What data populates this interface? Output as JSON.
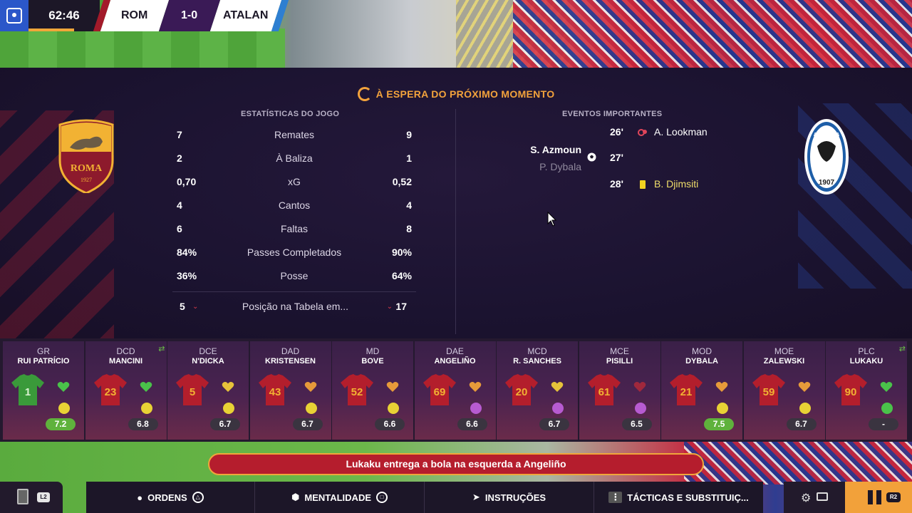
{
  "scoreboard": {
    "time": "62:46",
    "home": "ROM",
    "score": "1-0",
    "away": "ATALAN",
    "colors": {
      "home": "#a31a2a",
      "away": "#2e7fd1",
      "accent": "#f0a63a"
    }
  },
  "status": "À ESPERA DO PRÓXIMO MOMENTO",
  "stats": {
    "title": "ESTATÍSTICAS DO JOGO",
    "rows": [
      {
        "home": "7",
        "label": "Remates",
        "away": "9"
      },
      {
        "home": "2",
        "label": "À Baliza",
        "away": "1"
      },
      {
        "home": "0,70",
        "label": "xG",
        "away": "0,52"
      },
      {
        "home": "4",
        "label": "Cantos",
        "away": "4"
      },
      {
        "home": "6",
        "label": "Faltas",
        "away": "8"
      },
      {
        "home": "84%",
        "label": "Passes Completados",
        "away": "90%"
      },
      {
        "home": "36%",
        "label": "Posse",
        "away": "64%"
      }
    ],
    "table": {
      "home": "5",
      "label": "Posição na Tabela em...",
      "away": "17"
    }
  },
  "crests": {
    "home": {
      "name": "ROMA",
      "year": "1927"
    },
    "away": {
      "name": "ATALANTA",
      "year": "1907"
    }
  },
  "events": {
    "title": "EVENTOS IMPORTANTES",
    "items": [
      {
        "minute": "26'",
        "type": "injury-icon",
        "player": "A. Lookman",
        "side": "away"
      },
      {
        "minute": "27'",
        "type": "goal-icon",
        "player": "S. Azmoun",
        "assist": "P. Dybala",
        "side": "home"
      },
      {
        "minute": "28'",
        "type": "yellow-card-icon",
        "player": "B. Djimsiti",
        "side": "away"
      }
    ]
  },
  "players": [
    {
      "pos": "GR",
      "name": "RUI PATRÍCIO",
      "number": "1",
      "kit": "gk",
      "condition": "green",
      "morale": "yellow",
      "rating": "7.2",
      "good": true,
      "swap": false
    },
    {
      "pos": "DCD",
      "name": "MANCINI",
      "number": "23",
      "kit": "outfield",
      "condition": "green",
      "morale": "yellow",
      "rating": "6.8",
      "good": false,
      "swap": true
    },
    {
      "pos": "DCE",
      "name": "N'DICKA",
      "number": "5",
      "kit": "outfield",
      "condition": "yellow",
      "morale": "yellow",
      "rating": "6.7",
      "good": false,
      "swap": false
    },
    {
      "pos": "DAD",
      "name": "KRISTENSEN",
      "number": "43",
      "kit": "outfield",
      "condition": "orange",
      "morale": "yellow",
      "rating": "6.7",
      "good": false,
      "swap": false
    },
    {
      "pos": "MD",
      "name": "BOVE",
      "number": "52",
      "kit": "outfield",
      "condition": "orange",
      "morale": "yellow",
      "rating": "6.6",
      "good": false,
      "swap": false
    },
    {
      "pos": "DAE",
      "name": "ANGELIÑO",
      "number": "69",
      "kit": "outfield",
      "condition": "orange",
      "morale": "purple",
      "rating": "6.6",
      "good": false,
      "swap": false
    },
    {
      "pos": "MCD",
      "name": "R. SANCHES",
      "number": "20",
      "kit": "outfield",
      "condition": "yellow",
      "morale": "purple",
      "rating": "6.7",
      "good": false,
      "swap": false
    },
    {
      "pos": "MCE",
      "name": "PISILLI",
      "number": "61",
      "kit": "outfield",
      "condition": "red",
      "morale": "purple",
      "rating": "6.5",
      "good": false,
      "swap": false
    },
    {
      "pos": "MOD",
      "name": "DYBALA",
      "number": "21",
      "kit": "outfield",
      "condition": "orange",
      "morale": "yellow",
      "rating": "7.5",
      "good": true,
      "swap": false
    },
    {
      "pos": "MOE",
      "name": "ZALEWSKI",
      "number": "59",
      "kit": "outfield",
      "condition": "orange",
      "morale": "yellow",
      "rating": "6.7",
      "good": false,
      "swap": false
    },
    {
      "pos": "PLC",
      "name": "LUKAKU",
      "number": "90",
      "kit": "outfield",
      "condition": "green",
      "morale": "green",
      "rating": "-",
      "good": false,
      "swap": true
    }
  ],
  "commentary": "Lukaku entrega a bola na esquerda a Angeliño",
  "nav": {
    "back_glyph": "L2",
    "tabs": [
      {
        "label": "ORDENS",
        "icon": "speech-icon",
        "button": "△"
      },
      {
        "label": "MENTALIDADE",
        "icon": "shield-icon",
        "button": "□"
      },
      {
        "label": "INSTRUÇÕES",
        "icon": "megaphone-icon",
        "button": ""
      },
      {
        "label": "TÁCTICAS E SUBSTITUIÇ...",
        "icon": "tactics-icon",
        "button": ""
      }
    ],
    "pause_glyph": "R2"
  }
}
